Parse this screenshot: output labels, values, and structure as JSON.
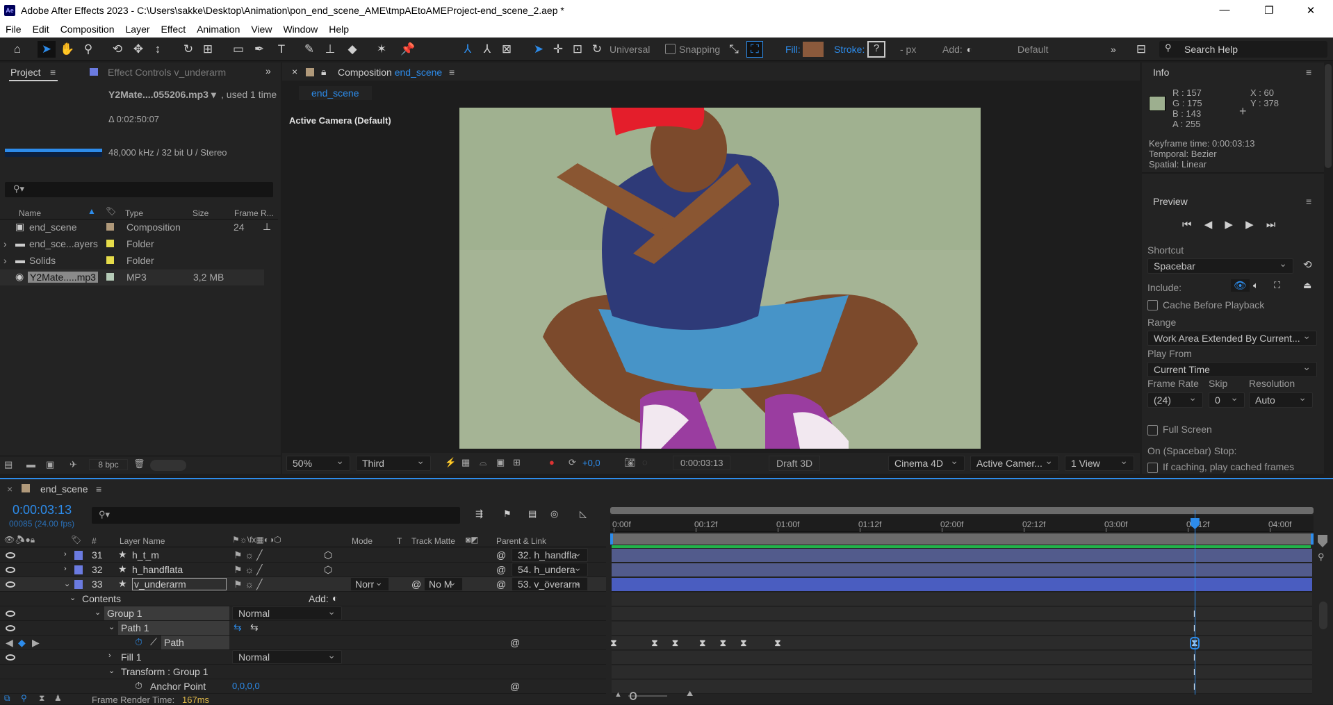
{
  "titlebar": {
    "app_icon": "Ae",
    "title": "Adobe After Effects 2023 - C:\\Users\\sakke\\Desktop\\Animation\\pon_end_scene_AME\\tmpAEtoAMEProject-end_scene_2.aep *",
    "minimize": "—",
    "maximize": "❐",
    "close": "✕"
  },
  "menu": [
    "File",
    "Edit",
    "Composition",
    "Layer",
    "Effect",
    "Animation",
    "View",
    "Window",
    "Help"
  ],
  "toolbar": {
    "axis_mode": "Universal",
    "snapping": "Snapping",
    "fill_label": "Fill:",
    "fill_color": "#8b5a3c",
    "stroke_label": "Stroke:",
    "stroke_value": "?",
    "stroke_unit": "- px",
    "add_label": "Add:",
    "workspace": "Default",
    "more": "»",
    "search_placeholder": "Search Help"
  },
  "project": {
    "tab": "Project",
    "tab2": "Effect Controls v_underarm",
    "more": "»",
    "selected_name": "Y2Mate....055206.mp3 ▾",
    "used": ", used 1 time",
    "duration": "Δ 0:02:50:07",
    "audio_info": "48,000 kHz / 32 bit U / Stereo",
    "columns": {
      "name": "Name",
      "type": "Type",
      "size": "Size",
      "frame_rate": "Frame R..."
    },
    "items": [
      {
        "name": "end_scene",
        "type": "Composition",
        "size": "",
        "fps": "24",
        "label_color": "#b0997a",
        "icon": "composition-icon"
      },
      {
        "name": "end_sce...ayers",
        "type": "Folder",
        "size": "",
        "fps": "",
        "label_color": "#e6dc4a",
        "icon": "folder-icon"
      },
      {
        "name": "Solids",
        "type": "Folder",
        "size": "",
        "fps": "",
        "label_color": "#e6dc4a",
        "icon": "folder-icon"
      },
      {
        "name": "Y2Mate.....mp3",
        "type": "MP3",
        "size": "3,2 MB",
        "fps": "",
        "label_color": "#b5cbb7",
        "icon": "audio-file-icon"
      }
    ],
    "bpc": "8 bpc"
  },
  "comp": {
    "close": "×",
    "tab_prefix": "Composition",
    "tab_name": "end_scene",
    "breadcrumb": "end_scene",
    "camera_label": "Active Camera (Default)",
    "footer": {
      "zoom": "50%",
      "resolution": "Third",
      "exposure": "+0,0",
      "timecode": "0:00:03:13",
      "draft": "Draft 3D",
      "renderer": "Cinema 4D",
      "camera": "Active Camer...",
      "views": "1 View"
    }
  },
  "info": {
    "title": "Info",
    "swatch": "#9daf8f",
    "r": "R :  157",
    "g": "G :  175",
    "b": "B :  143",
    "a": "A :  255",
    "x": "X : 60",
    "y": "Y : 378",
    "kf_time": "Keyframe time: 0:00:03:13",
    "temporal": "Temporal: Bezier",
    "spatial": "Spatial: Linear"
  },
  "preview": {
    "title": "Preview",
    "shortcut_label": "Shortcut",
    "shortcut": "Spacebar",
    "include_label": "Include:",
    "cache_label": "Cache Before Playback",
    "range_label": "Range",
    "range": "Work Area Extended By Current...",
    "play_from_label": "Play From",
    "play_from": "Current Time",
    "frame_rate_label": "Frame Rate",
    "frame_rate": "(24)",
    "skip_label": "Skip",
    "skip": "0",
    "resolution_label": "Resolution",
    "resolution": "Auto",
    "full_screen_label": "Full Screen",
    "stop_label": "On (Spacebar) Stop:",
    "if_caching_label": "If caching, play cached frames"
  },
  "timeline": {
    "close": "×",
    "comp_name": "end_scene",
    "timecode": "0:00:03:13",
    "frame_info": "00085 (24.00 fps)",
    "columns": {
      "num": "#",
      "layer_name": "Layer Name",
      "mode": "Mode",
      "t": "T",
      "track_matte": "Track Matte",
      "parent": "Parent & Link"
    },
    "layers": [
      {
        "num": "31",
        "name": "h_t_m",
        "parent": "32. h_handfla",
        "color": "#6b7be0"
      },
      {
        "num": "32",
        "name": "h_handflata",
        "parent": "54. h_undera",
        "color": "#6b7be0"
      },
      {
        "num": "33",
        "name": "v_underarm",
        "parent": "53. v_överarm",
        "mode": "Norr",
        "matte": "No M",
        "color": "#6b7be0"
      }
    ],
    "props": {
      "contents": "Contents",
      "add": "Add:",
      "group1": "Group 1",
      "group1_mode": "Normal",
      "path1": "Path 1",
      "path": "Path",
      "fill1": "Fill 1",
      "fill_mode": "Normal",
      "transform": "Transform : Group 1",
      "anchor": "Anchor Point",
      "anchor_value": "0,0,0,0"
    },
    "ruler": [
      "0:00f",
      "00:12f",
      "01:00f",
      "01:12f",
      "02:00f",
      "02:12f",
      "03:00f",
      "03:12f",
      "04:00f"
    ],
    "current_frame": 85,
    "path_keyframes_frames": [
      0,
      6,
      9,
      13,
      16,
      19,
      24,
      85
    ],
    "render_time_label": "Frame Render Time:",
    "render_time": "167ms"
  }
}
